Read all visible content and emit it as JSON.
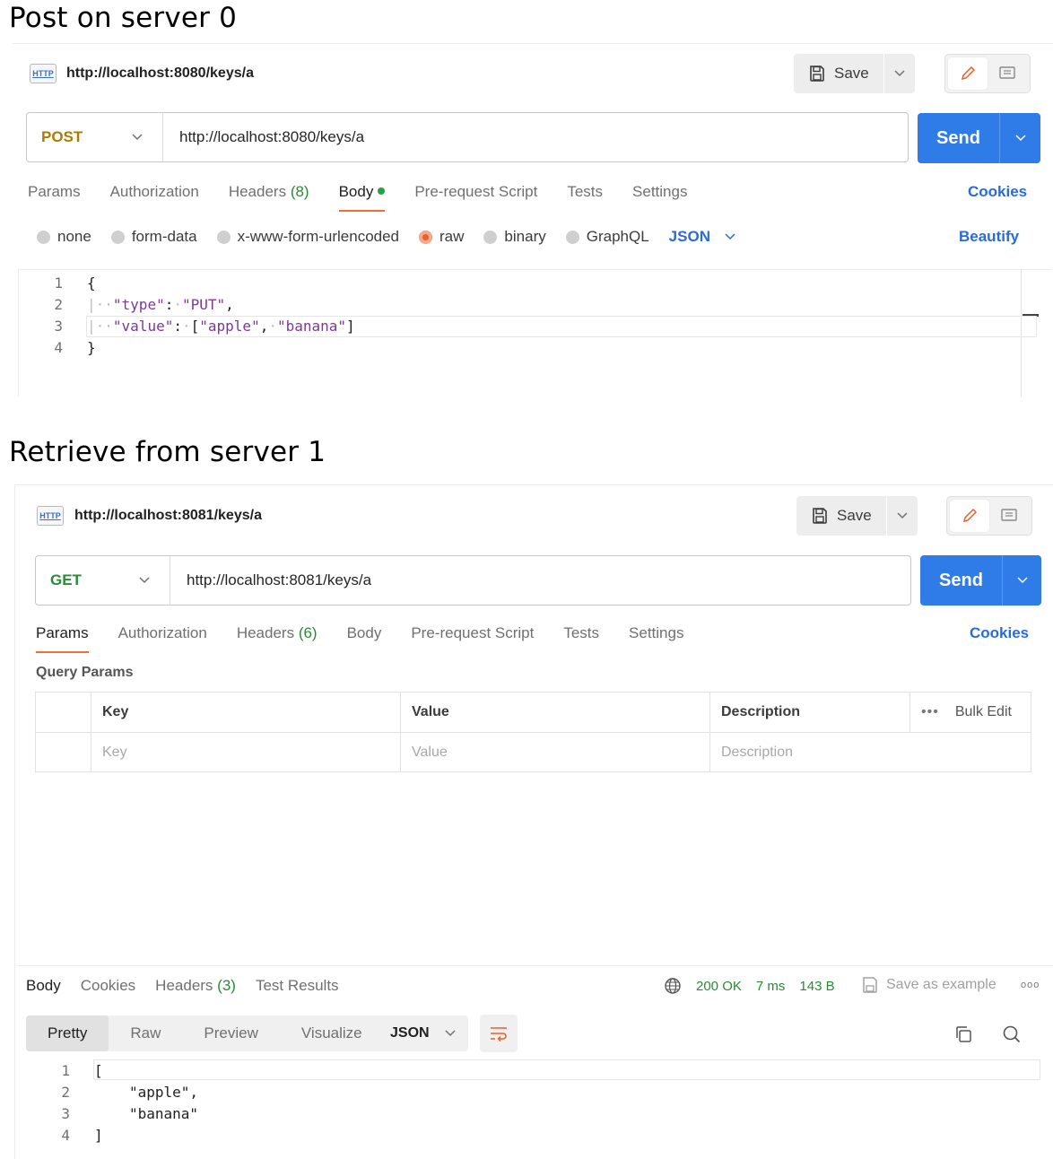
{
  "headings": {
    "post": "Post on server 0",
    "get": "Retrieve from server 1"
  },
  "post_panel": {
    "badge": "HTTP",
    "title": "http://localhost:8080/keys/a",
    "save_label": "Save",
    "method": "POST",
    "method_color": "#b07a00",
    "url": "http://localhost:8080/keys/a",
    "send_label": "Send",
    "tabs": {
      "params": "Params",
      "authorization": "Authorization",
      "headers": "Headers",
      "headers_count": "(8)",
      "body": "Body",
      "pre_request": "Pre-request Script",
      "tests": "Tests",
      "settings": "Settings"
    },
    "cookies": "Cookies",
    "body_types": {
      "none": "none",
      "form_data": "form-data",
      "urlencoded": "x-www-form-urlencoded",
      "raw": "raw",
      "binary": "binary",
      "graphql": "GraphQL"
    },
    "format": "JSON",
    "beautify": "Beautify",
    "code_lines": [
      "1",
      "2",
      "3",
      "4"
    ],
    "code": {
      "open": "{",
      "type_key": "\"type\"",
      "type_val": "\"PUT\"",
      "value_key": "\"value\"",
      "value_val_1": "\"apple\"",
      "value_val_2": "\"banana\"",
      "close": "}"
    }
  },
  "get_panel": {
    "badge": "HTTP",
    "title": "http://localhost:8081/keys/a",
    "save_label": "Save",
    "method": "GET",
    "method_color": "#2a8a37",
    "url": "http://localhost:8081/keys/a",
    "send_label": "Send",
    "tabs": {
      "params": "Params",
      "authorization": "Authorization",
      "headers": "Headers",
      "headers_count": "(6)",
      "body": "Body",
      "pre_request": "Pre-request Script",
      "tests": "Tests",
      "settings": "Settings"
    },
    "cookies": "Cookies",
    "query_params_label": "Query Params",
    "table": {
      "headers": [
        "Key",
        "Value",
        "Description"
      ],
      "bulk_edit": "Bulk Edit",
      "placeholders": [
        "Key",
        "Value",
        "Description"
      ]
    },
    "response": {
      "tabs": {
        "body": "Body",
        "cookies": "Cookies",
        "headers": "Headers",
        "headers_count": "(3)",
        "test_results": "Test Results"
      },
      "status": "200 OK",
      "time": "7 ms",
      "size": "143 B",
      "save_example": "Save as example",
      "views": [
        "Pretty",
        "Raw",
        "Preview",
        "Visualize"
      ],
      "format": "JSON",
      "code_lines": [
        "1",
        "2",
        "3",
        "4"
      ],
      "code": {
        "open": "[",
        "item1": "\"apple\",",
        "item2": "\"banana\"",
        "close": "]"
      }
    }
  }
}
